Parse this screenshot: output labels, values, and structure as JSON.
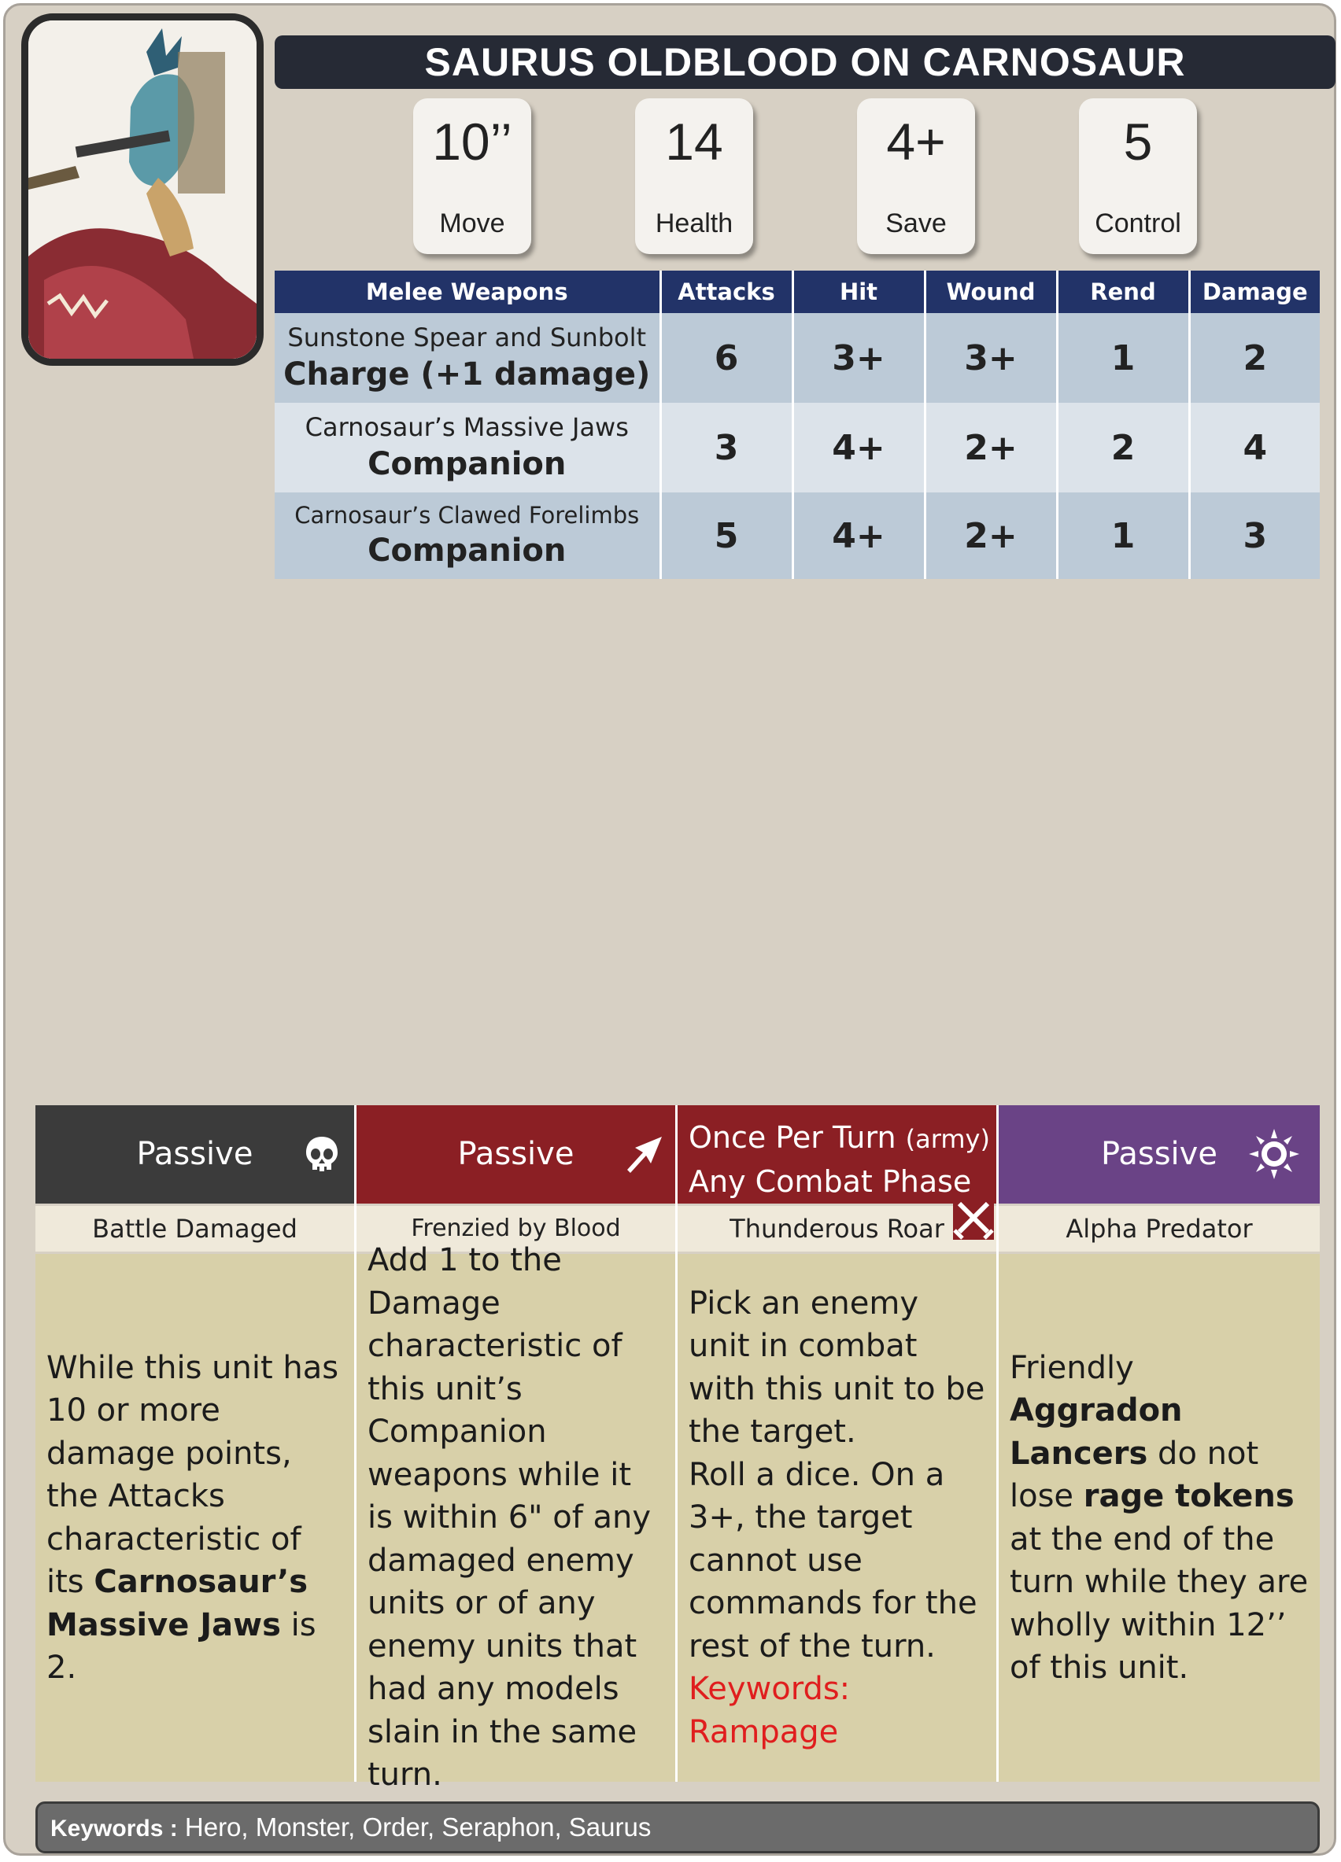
{
  "title": "SAURUS OLDBLOOD ON CARNOSAUR",
  "stats": [
    {
      "value": "10’’",
      "label": "Move"
    },
    {
      "value": "14",
      "label": "Health"
    },
    {
      "value": "4+",
      "label": "Save"
    },
    {
      "value": "5",
      "label": "Control"
    }
  ],
  "weapons": {
    "headers": [
      "Melee Weapons",
      "Attacks",
      "Hit",
      "Wound",
      "Rend",
      "Damage"
    ],
    "rows": [
      {
        "name": "Sunstone Spear and Sunbolt",
        "ability": "Charge (+1 damage)",
        "attacks": "6",
        "hit": "3+",
        "wound": "3+",
        "rend": "1",
        "damage": "2"
      },
      {
        "name": "Carnosaur’s Massive Jaws",
        "ability": "Companion",
        "attacks": "3",
        "hit": "4+",
        "wound": "2+",
        "rend": "2",
        "damage": "4"
      },
      {
        "name": "Carnosaur’s Clawed Forelimbs",
        "ability": "Companion",
        "attacks": "5",
        "hit": "4+",
        "wound": "2+",
        "rend": "1",
        "damage": "3"
      }
    ]
  },
  "abilities": [
    {
      "type": "Passive",
      "color": "#3b3b3b",
      "icon": "skull-icon",
      "name": "Battle Damaged",
      "text_1": "While this unit has 10 or more damage points, the Attacks characteristic of its ",
      "bold_1": "Carnosaur’s Massive Jaws",
      "text_2": " is 2."
    },
    {
      "type": "Passive",
      "color": "#8b1f24",
      "icon": "arrow-icon",
      "name": "Frenzied by Blood",
      "text": "Add 1 to the Damage characteristic of this unit’s Companion weapons while it is within 6\" of any damaged enemy units or of any enemy units that had any models slain in the same turn."
    },
    {
      "type_1": "Once Per Turn",
      "type_small": "(army)",
      "type_2": "Any Combat Phase",
      "color": "#8b1f24",
      "icon": "crossed-swords-icon",
      "name": "Thunderous Roar",
      "text_1": "Pick an enemy unit in combat with this unit to be the target.",
      "text_2": "Roll a dice. On a 3+, the target cannot use commands for the rest of the turn.",
      "keywords": "Keywords: Rampage"
    },
    {
      "type": "Passive",
      "color": "#6a4386",
      "icon": "sun-icon",
      "name": "Alpha Predator",
      "text_1": "Friendly ",
      "bold_1": "Aggradon Lancers",
      "text_2": " do not lose ",
      "bold_2": "rage tokens",
      "text_3": " at the end of the turn while they are wholly within 12’’ of this unit."
    }
  ],
  "keywords": {
    "label": "Keywords :",
    "value": " Hero, Monster, Order, Seraphon, Saurus"
  }
}
